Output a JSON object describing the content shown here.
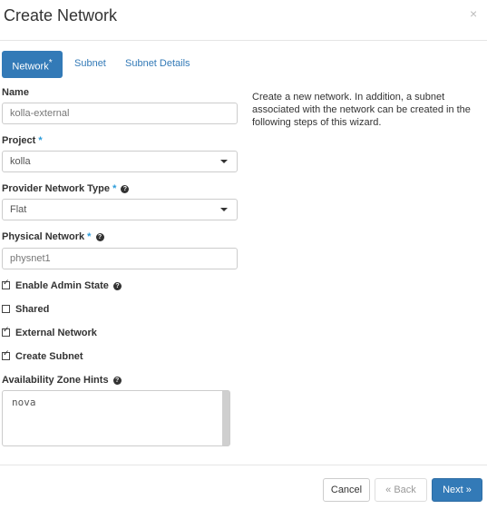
{
  "dialog": {
    "title": "Create Network",
    "close_icon": "×"
  },
  "tabs": [
    {
      "label": "Network",
      "required": "*"
    },
    {
      "label": "Subnet"
    },
    {
      "label": "Subnet Details"
    }
  ],
  "fields": {
    "name": {
      "label": "Name",
      "value": "kolla-external"
    },
    "project": {
      "label": "Project",
      "required": "*",
      "value": "kolla"
    },
    "provider_network_type": {
      "label": "Provider Network Type",
      "required": "*",
      "value": "Flat"
    },
    "physical_network": {
      "label": "Physical Network",
      "required": "*",
      "placeholder": "physnet1"
    },
    "availability_zone_hints": {
      "label": "Availability Zone Hints",
      "value": "nova"
    }
  },
  "checkboxes": [
    {
      "label": "Enable Admin State",
      "checked": true
    },
    {
      "label": "Shared",
      "checked": false
    },
    {
      "label": "External Network",
      "checked": true
    },
    {
      "label": "Create Subnet",
      "checked": true
    }
  ],
  "description": "Create a new network. In addition, a subnet associated with the network can be created in the following steps of this wizard.",
  "buttons": {
    "cancel": "Cancel",
    "back": "« Back",
    "next": "Next »"
  },
  "icons": {
    "help": "?"
  },
  "colors": {
    "primary": "#337ab7",
    "required": "#2b9cda"
  }
}
